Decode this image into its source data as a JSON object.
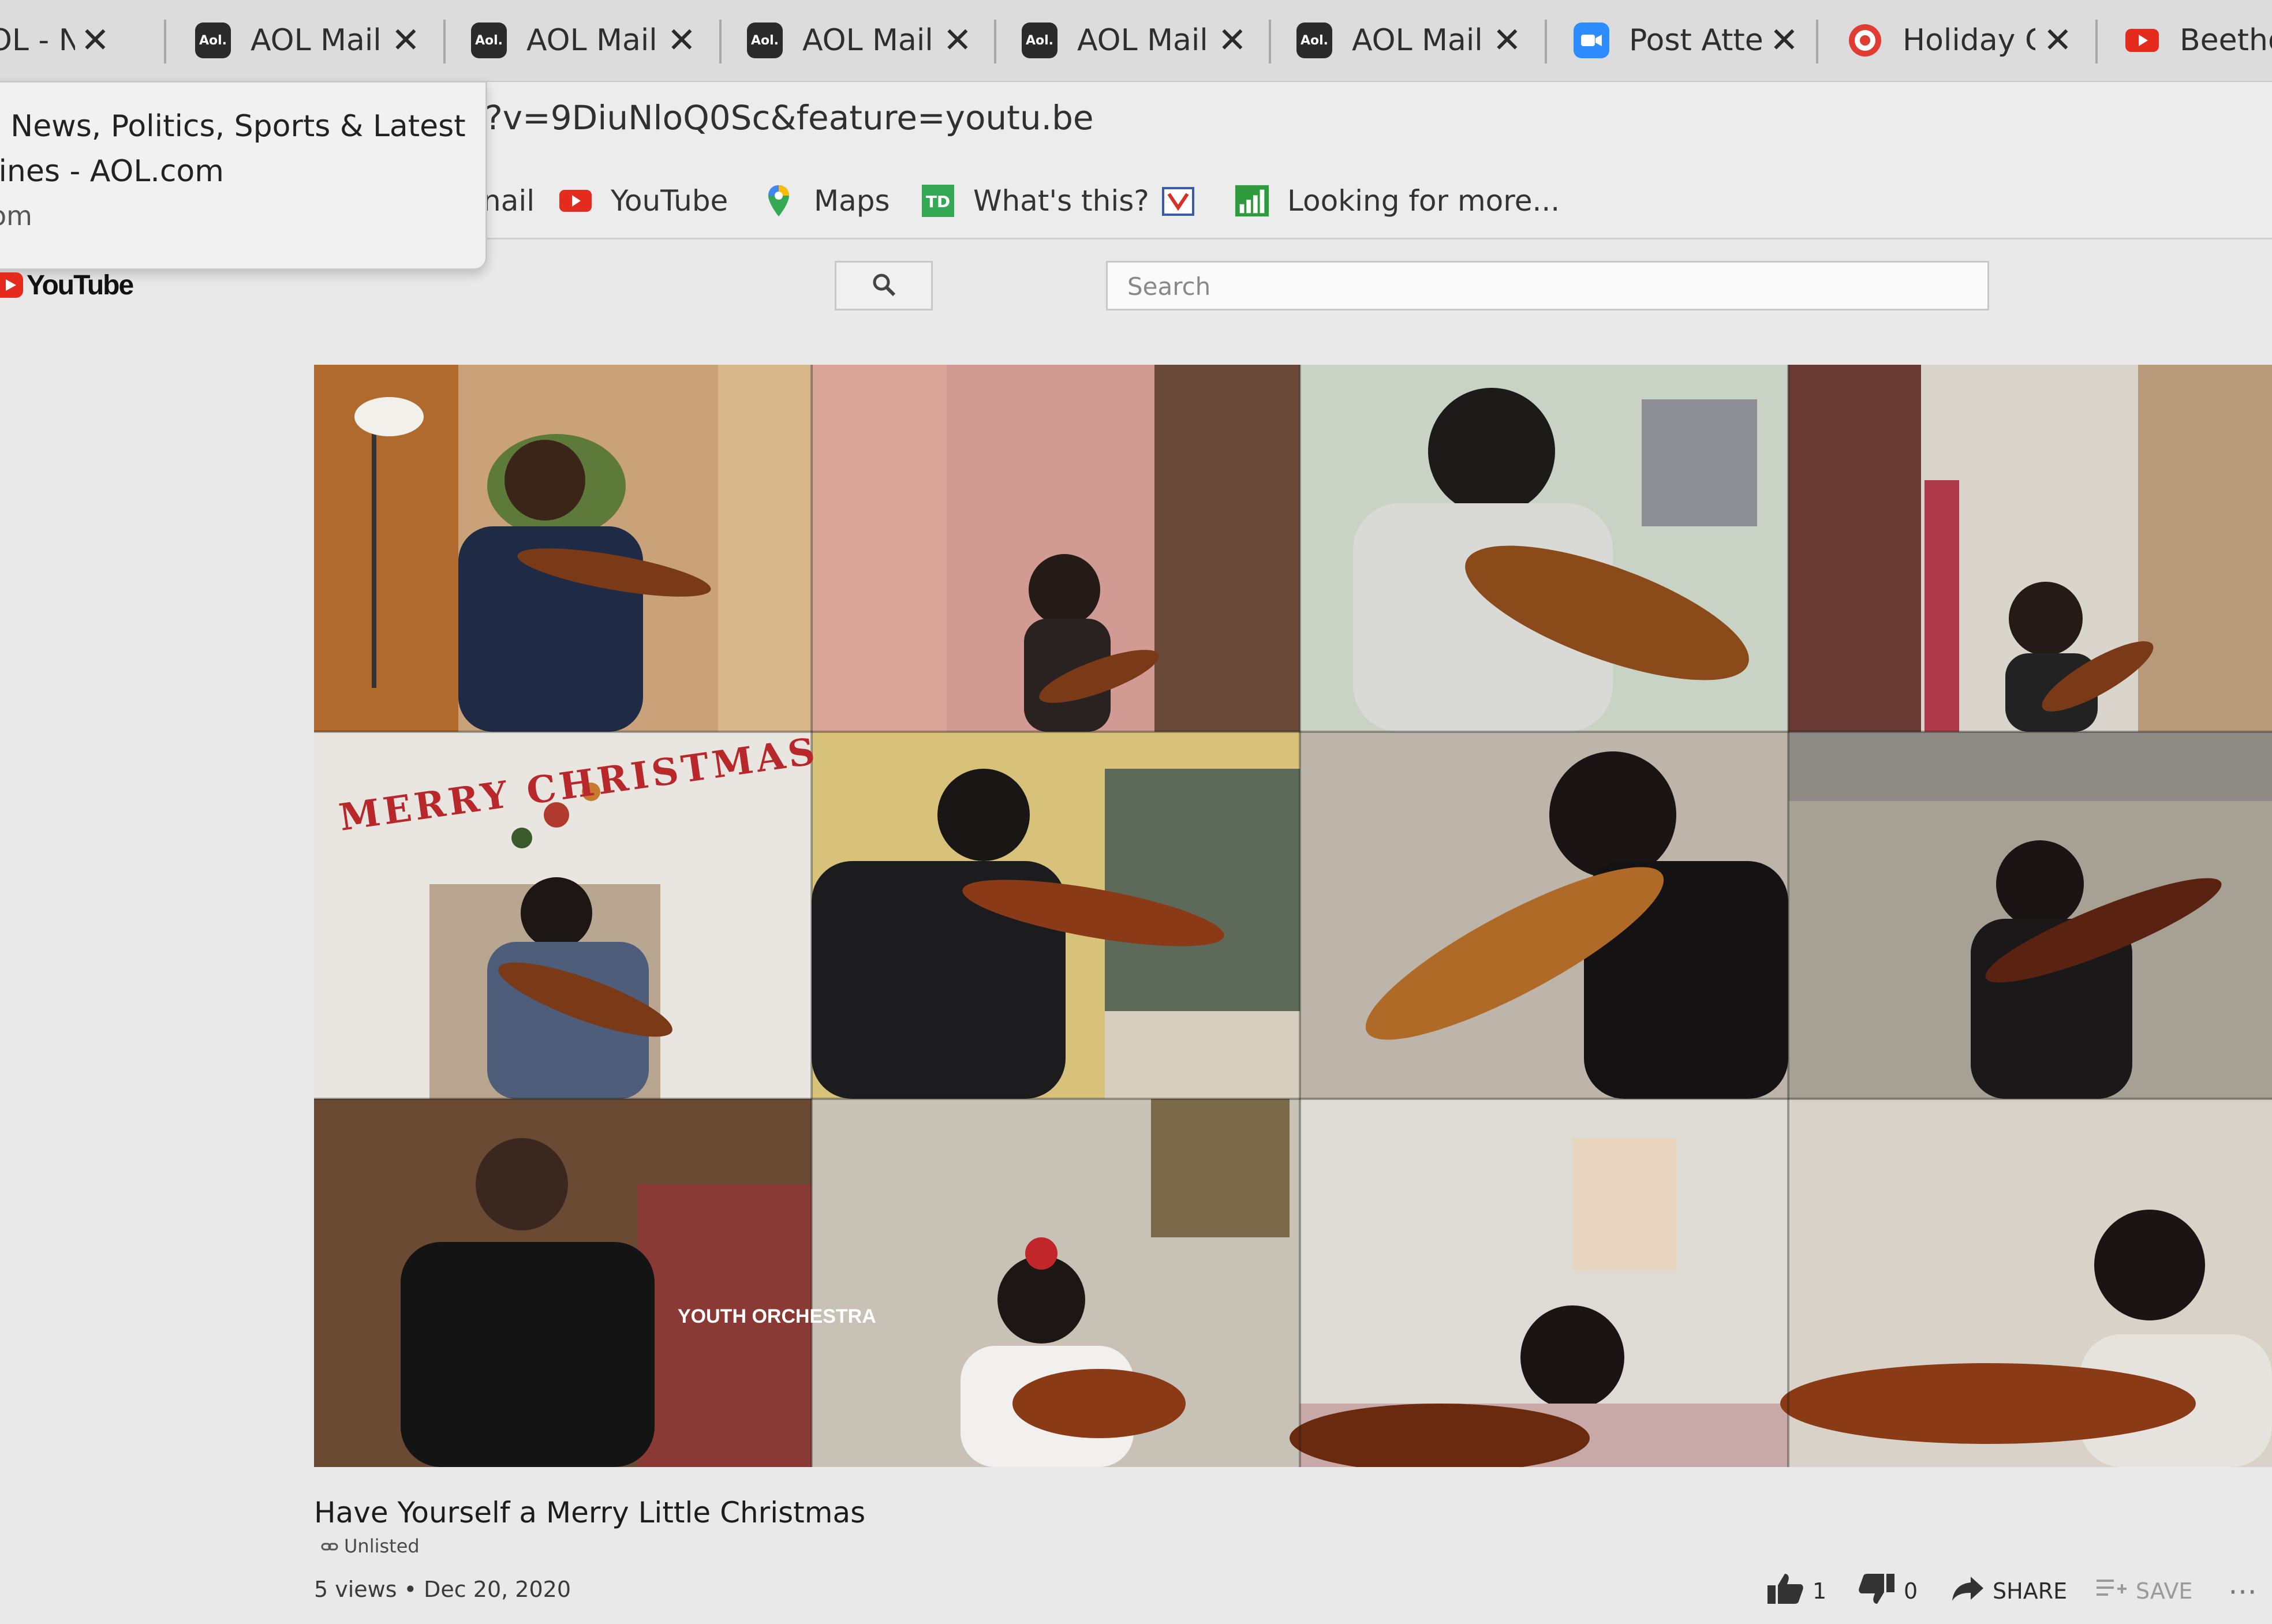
{
  "tabs": [
    {
      "title": "OL - New",
      "icon": "aol-news-icon",
      "icon_color": "#6d6d6d",
      "icon_text": ""
    },
    {
      "title": "AOL Mail (",
      "icon": "aol-icon",
      "icon_color": "#2a2a2a",
      "icon_text": "Aol."
    },
    {
      "title": "AOL Mail (",
      "icon": "aol-icon",
      "icon_color": "#2a2a2a",
      "icon_text": "Aol."
    },
    {
      "title": "AOL Mail (",
      "icon": "aol-icon",
      "icon_color": "#2a2a2a",
      "icon_text": "Aol."
    },
    {
      "title": "AOL Mail (",
      "icon": "aol-icon",
      "icon_color": "#2a2a2a",
      "icon_text": "Aol."
    },
    {
      "title": "AOL Mail (",
      "icon": "aol-icon",
      "icon_color": "#2a2a2a",
      "icon_text": "Aol."
    },
    {
      "title": "Post Atten",
      "icon": "zoom-icon",
      "icon_color": "#2d8cff",
      "icon_text": ""
    },
    {
      "title": "Holiday C",
      "icon": "target-icon",
      "icon_color": "#e03c31",
      "icon_text": ""
    },
    {
      "title": "Beethov",
      "icon": "youtube-icon",
      "icon_color": "#e52b1e",
      "icon_text": ""
    }
  ],
  "tab_close_glyph": "✕",
  "address_bar": {
    "url": "?v=9DiuNloQ0Sc&feature=youtu.be"
  },
  "tooltip": {
    "line1": "- News, Politics, Sports & Latest",
    "line2": "lines - AOL.com",
    "line3": "om"
  },
  "bookmarks": [
    {
      "label": "nail",
      "icon": "mail-icon"
    },
    {
      "label": "YouTube",
      "icon": "youtube-icon"
    },
    {
      "label": "Maps",
      "icon": "maps-pin-icon"
    },
    {
      "label": "What's this?",
      "icon": "td-bank-icon"
    },
    {
      "label": "",
      "icon": "calendar-icon"
    },
    {
      "label": "Looking for more...",
      "icon": "chart-bars-icon"
    }
  ],
  "youtube": {
    "logo_text": "YouTube",
    "search_placeholder": "Search"
  },
  "video": {
    "title": "Have Yourself a Merry Little Christmas",
    "privacy": "Unlisted",
    "views": "5 views",
    "separator": "•",
    "date": "Dec 20, 2020",
    "likes": "1",
    "dislikes": "0",
    "share_label": "SHARE",
    "save_label": "SAVE",
    "more_glyph": "⋯",
    "grid_banner_text": "MERRY CHRISTMAS",
    "poster_text": "YOUTH ORCHESTRA"
  },
  "colors": {
    "youtube_red": "#e52b1e",
    "tab_bg": "#dcdcdc"
  }
}
